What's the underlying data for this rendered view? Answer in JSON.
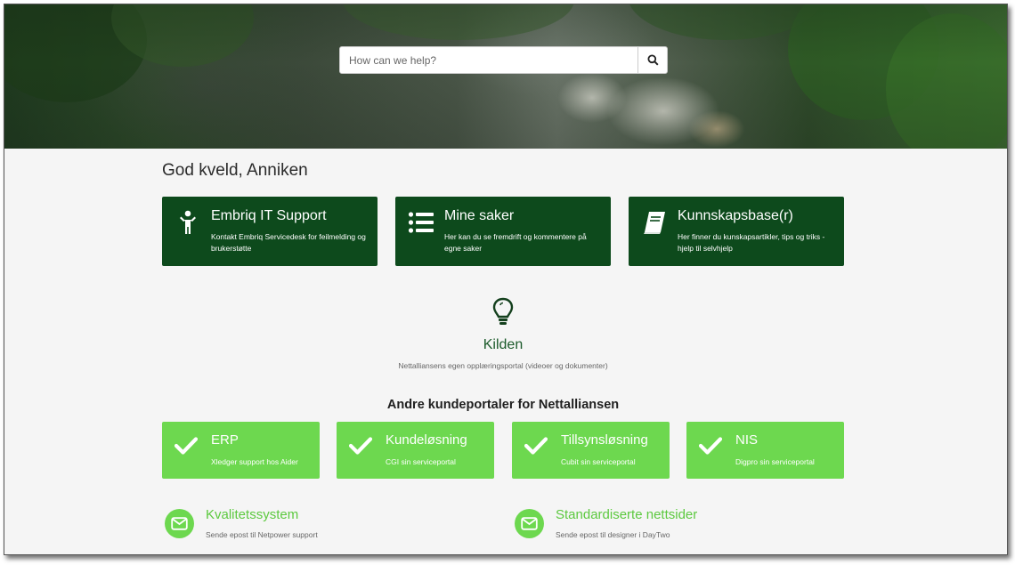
{
  "search": {
    "placeholder": "How can we help?",
    "icon": "search-icon"
  },
  "greeting": "God kveld, Anniken",
  "primary_tiles": [
    {
      "title": "Embriq IT Support",
      "description": "Kontakt Embriq Servicedesk for feilmelding og brukerstøtte",
      "icon": "person-icon"
    },
    {
      "title": "Mine saker",
      "description": "Her kan du se fremdrift og kommentere på egne saker",
      "icon": "list-icon"
    },
    {
      "title": "Kunnskapsbase(r)",
      "description": "Her finner du kunskapsartikler, tips og triks - hjelp til selvhjelp",
      "icon": "book-icon"
    }
  ],
  "kilden": {
    "title": "Kilden",
    "description": "Nettalliansens egen opplæringsportal (videoer og dokumenter)",
    "icon": "lightbulb-icon"
  },
  "other_portals": {
    "title": "Andre kundeportaler for Nettalliansen",
    "tiles": [
      {
        "title": "ERP",
        "description": "Xledger support hos Aider"
      },
      {
        "title": "Kundeløsning",
        "description": "CGI sin serviceportal"
      },
      {
        "title": "Tillsynsløsning",
        "description": "Cubit sin serviceportal"
      },
      {
        "title": "NIS",
        "description": "Digpro sin serviceportal"
      }
    ]
  },
  "mail_links": [
    {
      "title": "Kvalitetssystem",
      "description": "Sende epost til Netpower support"
    },
    {
      "title": "Standardiserte nettsider",
      "description": "Sende epost til designer i DayTwo"
    }
  ],
  "colors": {
    "dark_green": "#0d4a1c",
    "light_green": "#6dd84f",
    "link_green": "#5cc93f"
  }
}
